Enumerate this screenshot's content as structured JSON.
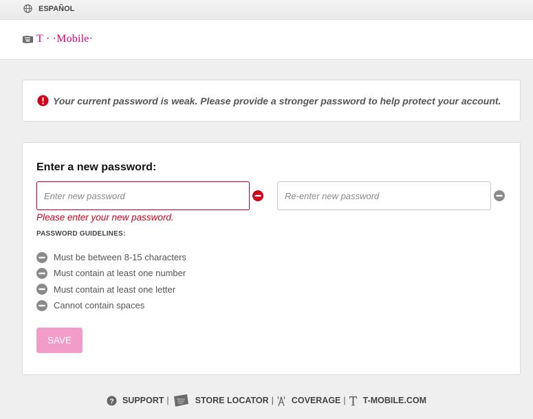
{
  "topbar": {
    "language_label": "ESPAÑOL",
    "icon": "globe-icon"
  },
  "header": {
    "logo_text": "T · ·Mobile·",
    "brand_color": "#e20074"
  },
  "alert": {
    "icon": "error-icon",
    "message": "Your current password is weak. Please provide a stronger password to help protect your account."
  },
  "form": {
    "heading": "Enter a new password:",
    "new_password": {
      "placeholder": "Enter new password",
      "value": ""
    },
    "confirm_password": {
      "placeholder": "Re-enter new password",
      "value": ""
    },
    "error_message": "Please enter your new password.",
    "guidelines_title": "PASSWORD GUIDELINES:",
    "guidelines": [
      "Must be between 8-15 characters",
      "Must contain at least one number",
      "Must contain at least one letter",
      "Cannot contain spaces"
    ],
    "save_label": "SAVE"
  },
  "footer": {
    "links": [
      {
        "label": "SUPPORT",
        "icon": "help-icon"
      },
      {
        "label": "STORE LOCATOR",
        "icon": "store-icon"
      },
      {
        "label": "COVERAGE",
        "icon": "tower-icon"
      },
      {
        "label": "T-MOBILE.COM",
        "icon": "tmobile-t-icon"
      }
    ],
    "separator": "|"
  },
  "colors": {
    "error_red": "#d0021b",
    "save_pink": "#f29cc9",
    "neutral_icon": "#8a8a8a"
  }
}
